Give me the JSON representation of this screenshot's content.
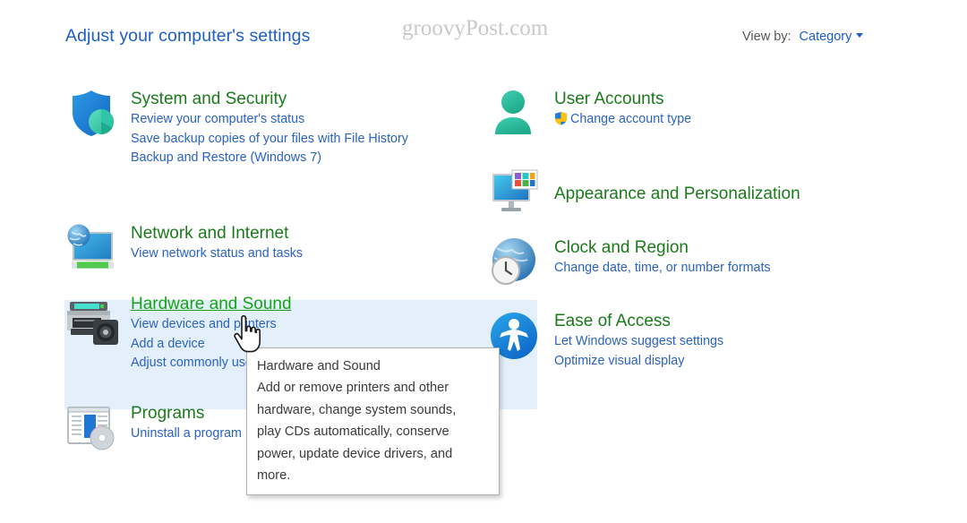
{
  "header": {
    "page_title": "Adjust your computer's settings",
    "watermark": "groovyPost.com",
    "view_by_label": "View by:",
    "view_by_value": "Category",
    "caret_icon": "chevron-down-icon"
  },
  "left_column": [
    {
      "icon": "shield-security-icon",
      "title": "System and Security",
      "links": [
        "Review your computer's status",
        "Save backup copies of your files with File History",
        "Backup and Restore (Windows 7)"
      ]
    },
    {
      "icon": "network-globe-monitor-icon",
      "title": "Network and Internet",
      "links": [
        "View network status and tasks"
      ]
    },
    {
      "icon": "printer-camera-icon",
      "title": "Hardware and Sound",
      "highlighted": true,
      "links": [
        "View devices and printers",
        "Add a device",
        "Adjust commonly used mobility settings"
      ]
    },
    {
      "icon": "programs-disc-icon",
      "title": "Programs",
      "links": [
        "Uninstall a program"
      ]
    }
  ],
  "right_column": [
    {
      "icon": "user-person-icon",
      "title": "User Accounts",
      "links": [
        {
          "text": "Change account type",
          "icon": "uac-shield-icon"
        }
      ]
    },
    {
      "icon": "appearance-monitor-icon",
      "title": "Appearance and Personalization",
      "links": []
    },
    {
      "icon": "clock-globe-icon",
      "title": "Clock and Region",
      "links": [
        {
          "text": "Change date, time, or number formats"
        }
      ]
    },
    {
      "icon": "ease-of-access-icon",
      "title": "Ease of Access",
      "links": [
        {
          "text": "Let Windows suggest settings"
        },
        {
          "text": "Optimize visual display"
        }
      ]
    }
  ],
  "tooltip": {
    "lines": [
      "Hardware and Sound",
      "Add or remove printers and other",
      "hardware, change system sounds,",
      "play CDs automatically, conserve",
      "power, update device drivers, and",
      "more."
    ]
  },
  "cursor": {
    "icon": "hand-pointer-cursor"
  },
  "colors": {
    "category_title": "#1b7a1b",
    "category_title_hover": "#17a317",
    "link": "#2a62c4",
    "page_title": "#1c5fc7",
    "highlight_band": "#e3f0fb",
    "watermark": "#c9c9c9"
  }
}
